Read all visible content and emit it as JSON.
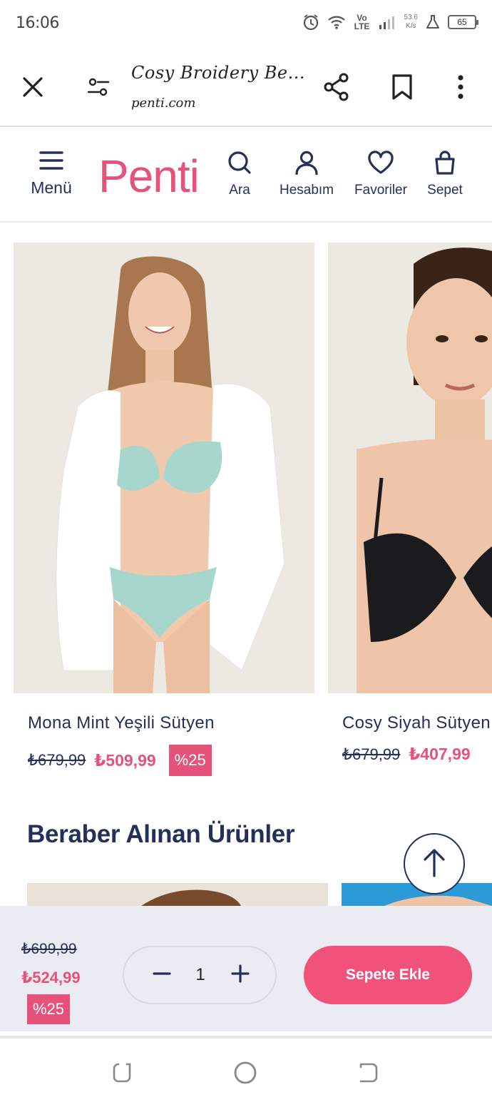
{
  "status_bar": {
    "time": "16:06",
    "network": "Vo LTE",
    "speed_value": "53.6",
    "speed_unit": "K/s",
    "battery": "65"
  },
  "browser": {
    "page_title": "Cosy Broidery Be...",
    "domain": "penti.com"
  },
  "site_header": {
    "logo": "Penti",
    "menu_label": "Menü",
    "nav": [
      {
        "label": "Ara",
        "icon": "search-icon"
      },
      {
        "label": "Hesabım",
        "icon": "user-icon"
      },
      {
        "label": "Favoriler",
        "icon": "heart-icon"
      },
      {
        "label": "Sepet",
        "icon": "shopping-bag-icon"
      }
    ]
  },
  "products": [
    {
      "name": "Mona Mint Yeşili Sütyen",
      "old_price": "₺679,99",
      "new_price": "₺509,99",
      "discount": "%25"
    },
    {
      "name": "Cosy Siyah Sütyen",
      "old_price": "₺679,99",
      "new_price": "₺407,99"
    }
  ],
  "section_title": "Beraber Alınan Ürünler",
  "cart_bar": {
    "old_price": "₺699,99",
    "new_price": "₺524,99",
    "discount": "%25",
    "quantity": "1",
    "add_button": "Sepete Ekle"
  },
  "colors": {
    "brand_pink": "#e6527a",
    "navy": "#25305a",
    "cart_bar_bg": "#ebebf3"
  }
}
